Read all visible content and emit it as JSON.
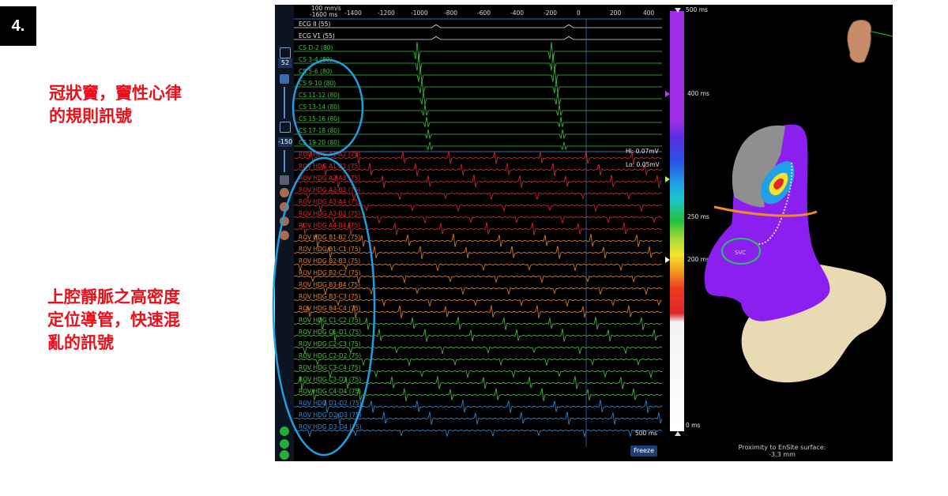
{
  "slide": {
    "number": "4.",
    "note_cs": "冠狀竇，竇性心律\n的規則訊號",
    "note_hdg": "上腔靜脈之高密度\n定位導管，快速混\n亂的訊號"
  },
  "ecg": {
    "sweep": "100 mm/s",
    "axis_start": "-1600 ms",
    "ticks": [
      "-1400",
      "-1200",
      "-1000",
      "-800",
      "-600",
      "-400",
      "-200",
      "0",
      "200",
      "400"
    ],
    "gain_value": "52",
    "scale_value": "-150",
    "hi_label": "Hi: 0.07mV",
    "lo_label": "Lo: 0.05mV",
    "time_scale": "500 ms",
    "freeze_label": "Freeze",
    "channels": [
      {
        "label": "ECG II (55)",
        "color": "#e6e6e6"
      },
      {
        "label": "ECG V1 (55)",
        "color": "#e6e6e6"
      },
      {
        "label": "CS   D-2 (80)",
        "color": "#3ec43e"
      },
      {
        "label": "CS   3-4 (80)",
        "color": "#3ec43e"
      },
      {
        "label": "CS   5-6 (80)",
        "color": "#3ec43e"
      },
      {
        "label": "CS   9-10 (80)",
        "color": "#3ec43e"
      },
      {
        "label": "CS   11-12 (80)",
        "color": "#3ec43e"
      },
      {
        "label": "CS   13-14 (80)",
        "color": "#3ec43e"
      },
      {
        "label": "CS   15-16 (80)",
        "color": "#3ec43e"
      },
      {
        "label": "CS   17-18 (80)",
        "color": "#3ec43e"
      },
      {
        "label": "CS   19-20 (80)",
        "color": "#3ec43e"
      },
      {
        "label": "ROV HDG  A1-A2 (75)",
        "color": "#e0282b"
      },
      {
        "label": "ROV HDG  A1-B1 (75)",
        "color": "#e0282b"
      },
      {
        "label": "ROV HDG  A2-A3 (75)",
        "color": "#e0282b"
      },
      {
        "label": "ROV HDG  A2-B2 (75)",
        "color": "#e0282b"
      },
      {
        "label": "ROV HDG  A3-A4 (75)",
        "color": "#e0282b"
      },
      {
        "label": "ROV HDG  A3-B3 (75)",
        "color": "#e0282b"
      },
      {
        "label": "ROV HDG  A4-B4 (75)",
        "color": "#e0282b"
      },
      {
        "label": "ROV HDG  B1-B2 (75)",
        "color": "#e8841f"
      },
      {
        "label": "ROV HDG  B1-C1 (75)",
        "color": "#e8841f"
      },
      {
        "label": "ROV HDG  B2-B3 (75)",
        "color": "#e8841f"
      },
      {
        "label": "ROV HDG  B2-C2 (75)",
        "color": "#e8841f"
      },
      {
        "label": "ROV HDG  B3-B4 (75)",
        "color": "#e8841f"
      },
      {
        "label": "ROV HDG  B3-C3 (75)",
        "color": "#e8841f"
      },
      {
        "label": "ROV HDG  B4-C4 (75)",
        "color": "#e8841f"
      },
      {
        "label": "ROV HDG  C1-C2 (75)",
        "color": "#4cc43a"
      },
      {
        "label": "ROV HDG  C1-D1 (75)",
        "color": "#4cc43a"
      },
      {
        "label": "ROV HDG  C2-C3 (75)",
        "color": "#4cc43a"
      },
      {
        "label": "ROV HDG  C2-D2 (75)",
        "color": "#4cc43a"
      },
      {
        "label": "ROV HDG  C3-C4 (75)",
        "color": "#4cc43a"
      },
      {
        "label": "ROV HDG  C3-D3 (75)",
        "color": "#4cc43a"
      },
      {
        "label": "ROV HDG  C4-D4 (75)",
        "color": "#4cc43a"
      },
      {
        "label": "ROV HDG  D1-D2 (75)",
        "color": "#2f8fd8"
      },
      {
        "label": "ROV HDG  D2-D3 (75)",
        "color": "#2f8fd8"
      },
      {
        "label": "ROV HDG  D3-D4 (75)",
        "color": "#2f8fd8"
      }
    ]
  },
  "colorbar": {
    "top": "500 ms",
    "mid1": "400 ms",
    "mid2": "250 ms",
    "mid3": "200 ms",
    "bottom": "0 ms"
  },
  "map": {
    "proximity_label": "Proximity to EnSite surface:",
    "proximity_value": "-3.3 mm",
    "annotation": "SVC"
  },
  "colors": {
    "annotation_red": "#e8101a",
    "highlight_blue": "#1e9fe0",
    "chamber_purple": "#8a1ff0"
  }
}
